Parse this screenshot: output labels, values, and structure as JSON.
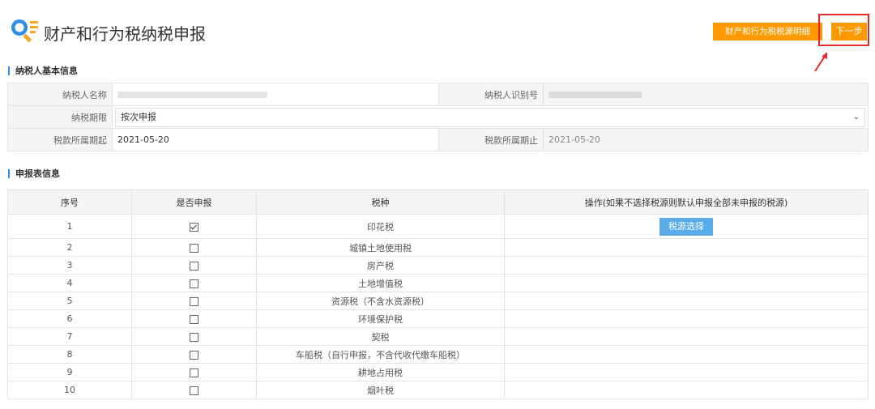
{
  "page": {
    "title": "财产和行为税纳税申报",
    "detail_button": "财产和行为税税源明细",
    "next_button": "下一步"
  },
  "basic_info": {
    "section_title": "纳税人基本信息",
    "taxpayer_name_label": "纳税人名称",
    "taxpayer_id_label": "纳税人识别号",
    "period_label": "纳税期限",
    "period_value": "按次申报",
    "start_label": "税款所属期起",
    "start_value": "2021-05-20",
    "end_label": "税款所属期止",
    "end_value": "2021-05-20"
  },
  "declaration": {
    "section_title": "申报表信息",
    "headers": [
      "序号",
      "是否申报",
      "税种",
      "操作(如果不选择税源则默认申报全部未申报的税源)"
    ],
    "source_button": "税源选择",
    "rows": [
      {
        "no": "1",
        "checked": true,
        "tax": "印花税"
      },
      {
        "no": "2",
        "checked": false,
        "tax": "城镇土地使用税"
      },
      {
        "no": "3",
        "checked": false,
        "tax": "房产税"
      },
      {
        "no": "4",
        "checked": false,
        "tax": "土地增值税"
      },
      {
        "no": "5",
        "checked": false,
        "tax": "资源税（不含水资源税）"
      },
      {
        "no": "6",
        "checked": false,
        "tax": "环境保护税"
      },
      {
        "no": "7",
        "checked": false,
        "tax": "契税"
      },
      {
        "no": "8",
        "checked": false,
        "tax": "车船税（自行申报，不含代收代缴车船税）"
      },
      {
        "no": "9",
        "checked": false,
        "tax": "耕地占用税"
      },
      {
        "no": "10",
        "checked": false,
        "tax": "烟叶税"
      }
    ]
  },
  "icons": {
    "logo": "search-list-icon",
    "dropdown": "chevron-down-icon",
    "annotation": "red-arrow-icon"
  },
  "colors": {
    "accent": "#ff9900",
    "primary_blue": "#58acea",
    "highlight": "#e52b2b"
  }
}
